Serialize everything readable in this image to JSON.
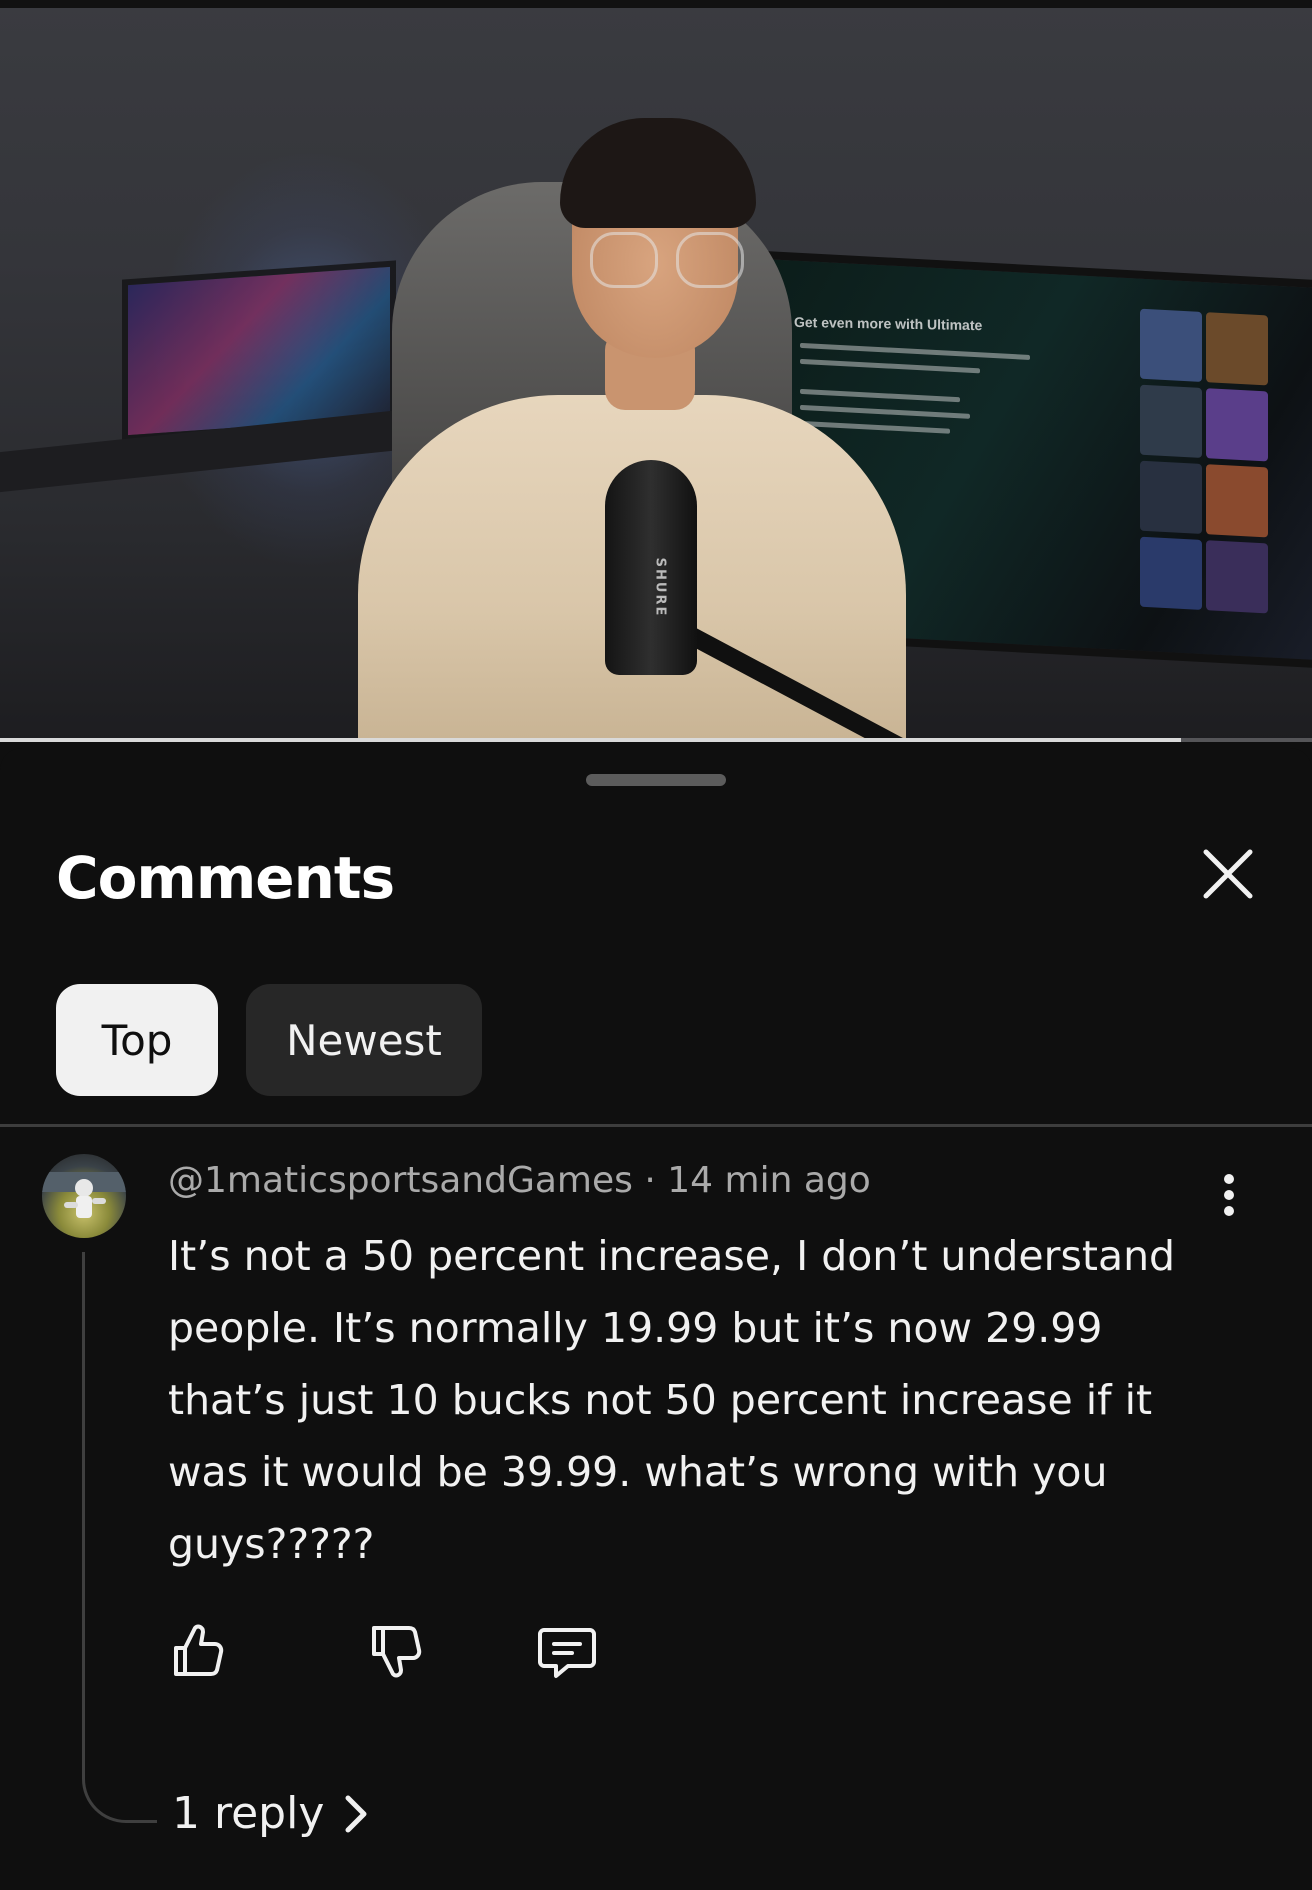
{
  "video": {
    "progress_fraction": 0.9,
    "monitor_headline": "Get even more with Ultimate",
    "mic_brand": "SHURE"
  },
  "comments_panel": {
    "title": "Comments",
    "close_icon": "close-icon",
    "filters": [
      {
        "label": "Top",
        "selected": true
      },
      {
        "label": "Newest",
        "selected": false
      }
    ]
  },
  "comment": {
    "author": "@1maticsportsandGames",
    "separator": "·",
    "time": "14 min ago",
    "text": "It’s not a 50 percent increase, I don’t understand people. It’s normally 19.99 but it’s now 29.99 that’s just 10 bucks not 50 percent increase if it was it would be 39.99. what’s wrong with you guys?????",
    "actions": [
      "thumbs-up-icon",
      "thumbs-down-icon",
      "reply-comment-icon"
    ],
    "reply_count_label": "1 reply"
  },
  "colors": {
    "background": "#0f0f0f",
    "chip_selected": "#f1f1f1",
    "chip_default": "#272727",
    "secondary_text": "#aaaaaa"
  }
}
